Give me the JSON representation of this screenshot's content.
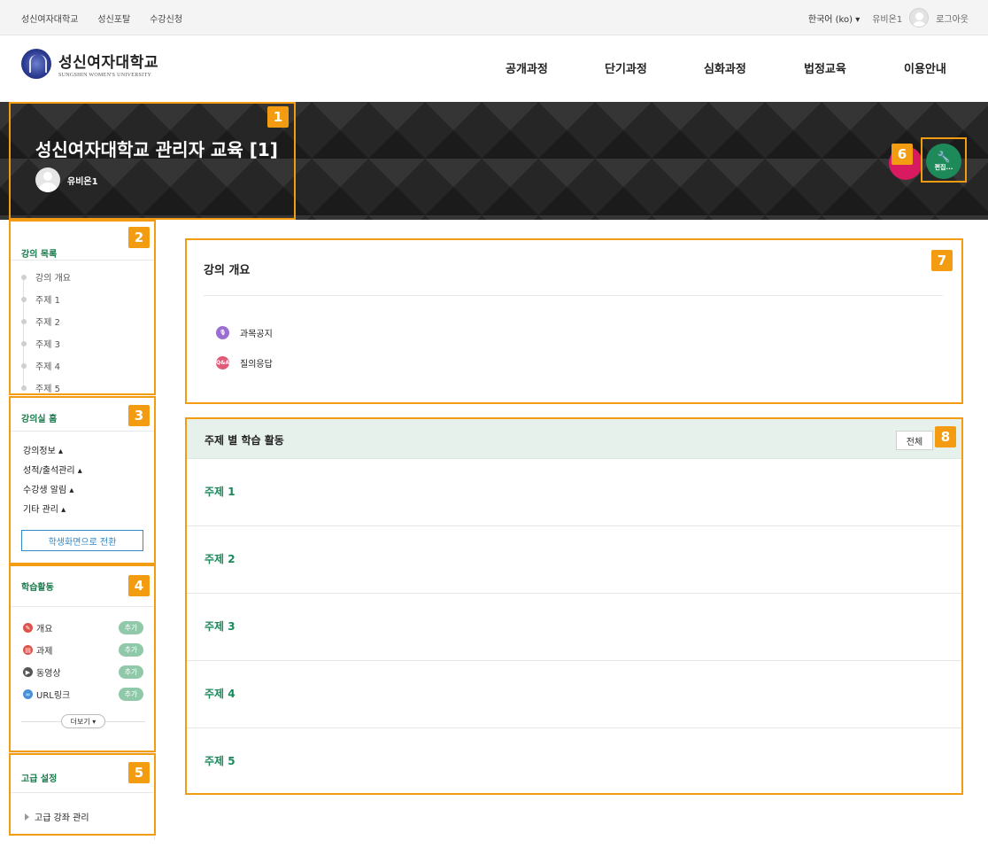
{
  "topbar": {
    "links": [
      "성신여자대학교",
      "성신포탈",
      "수강신청"
    ],
    "language": "한국어 (ko) ▾",
    "username": "유비온1",
    "logout": "로그아웃"
  },
  "header": {
    "logo_ko": "성신여자대학교",
    "logo_en": "SUNGSHIN WOMEN'S UNIVERSITY",
    "nav": [
      "공개과정",
      "단기과정",
      "심화과정",
      "법정교육",
      "이용안내"
    ]
  },
  "hero": {
    "course_title": "성신여자대학교 관리자 교육 [1]",
    "user_name": "유비온1",
    "edit_label": "편집..."
  },
  "badges": [
    "1",
    "2",
    "3",
    "4",
    "5",
    "6",
    "7",
    "8"
  ],
  "sidebar": {
    "course_list_title": "강의 목록",
    "course_items": [
      "강의 개요",
      "주제 1",
      "주제 2",
      "주제 3",
      "주제 4",
      "주제 5"
    ],
    "home_title": "강의실 홈",
    "home_items": [
      "강의정보 ▴",
      "성적/출석관리 ▴",
      "수강생 알림 ▴",
      "기타 관리 ▴"
    ],
    "student_view_button": "학생화면으로 전환",
    "activities_title": "학습활동",
    "activities": [
      {
        "label": "개요",
        "add": "추가"
      },
      {
        "label": "과제",
        "add": "추가"
      },
      {
        "label": "동영상",
        "add": "추가"
      },
      {
        "label": "URL링크",
        "add": "추가"
      }
    ],
    "more_button": "더보기 ▾",
    "advanced_title": "고급 설정",
    "advanced_item": "고급 강좌 관리"
  },
  "overview": {
    "title": "강의 개요",
    "items": [
      {
        "label": "과목공지",
        "icon": "microphone-icon",
        "color": "#9b6fd1"
      },
      {
        "label": "질의응답",
        "icon": "qna-icon",
        "icon_text": "Q&A",
        "color": "#e05a78"
      }
    ]
  },
  "topics": {
    "title": "주제 별 학습 활동",
    "all_button": "전체",
    "items": [
      "주제 1",
      "주제 2",
      "주제 3",
      "주제 4",
      "주제 5"
    ]
  },
  "colors": {
    "accent_green": "#1a8a5a",
    "annotation_orange": "#f39c12",
    "header_green_bg": "#e7f1ec"
  }
}
